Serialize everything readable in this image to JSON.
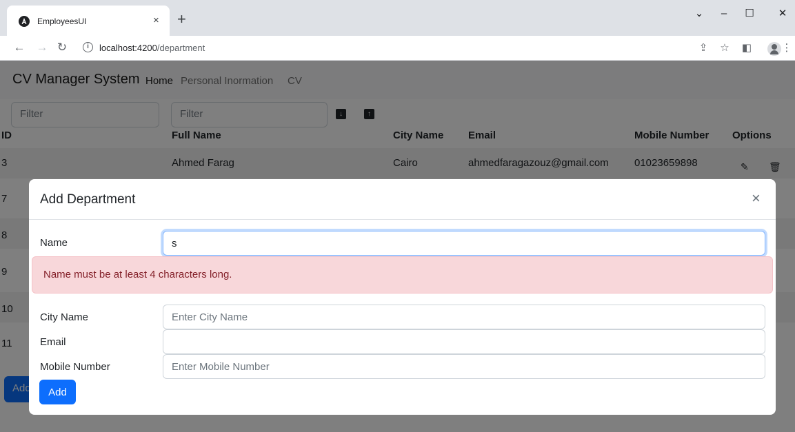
{
  "browser": {
    "tab_title": "EmployeesUI",
    "tab_close": "×",
    "new_tab": "+",
    "url_host": "localhost:4200",
    "url_path": "/department",
    "window_controls": {
      "minimize": "–",
      "maximize": "☐",
      "close": "✕",
      "tabs_menu": "⌄"
    }
  },
  "app": {
    "brand": "CV Manager System",
    "nav": [
      "Home",
      "Personal Inormation",
      "CV"
    ],
    "filters": {
      "id_placeholder": "Filter",
      "name_placeholder": "Filter"
    },
    "table": {
      "headers": [
        "ID",
        "Full Name",
        "City Name",
        "Email",
        "Mobile Number",
        "Options"
      ],
      "rows": [
        {
          "id": "3",
          "full_name": "Ahmed Farag",
          "city": "Cairo",
          "email": "ahmedfaragazouz@gmail.com",
          "mobile": "01023659898"
        },
        {
          "id": "7"
        },
        {
          "id": "8"
        },
        {
          "id": "9"
        },
        {
          "id": "10"
        },
        {
          "id": "11"
        }
      ]
    },
    "add_button": "Add"
  },
  "modal": {
    "title": "Add Department",
    "close": "×",
    "fields": {
      "name": {
        "label": "Name",
        "value": "s",
        "placeholder": ""
      },
      "city": {
        "label": "City Name",
        "value": "",
        "placeholder": "Enter City Name"
      },
      "email": {
        "label": "Email",
        "value": "",
        "placeholder": ""
      },
      "mobile": {
        "label": "Mobile Number",
        "value": "",
        "placeholder": "Enter Mobile Number"
      }
    },
    "error": "Name must be at least 4 characters long.",
    "submit": "Add"
  },
  "colors": {
    "primary": "#0d6efd",
    "alert_bg": "#f8d7da",
    "alert_text": "#842029",
    "backdrop": "rgba(0,0,0,0.5)"
  }
}
